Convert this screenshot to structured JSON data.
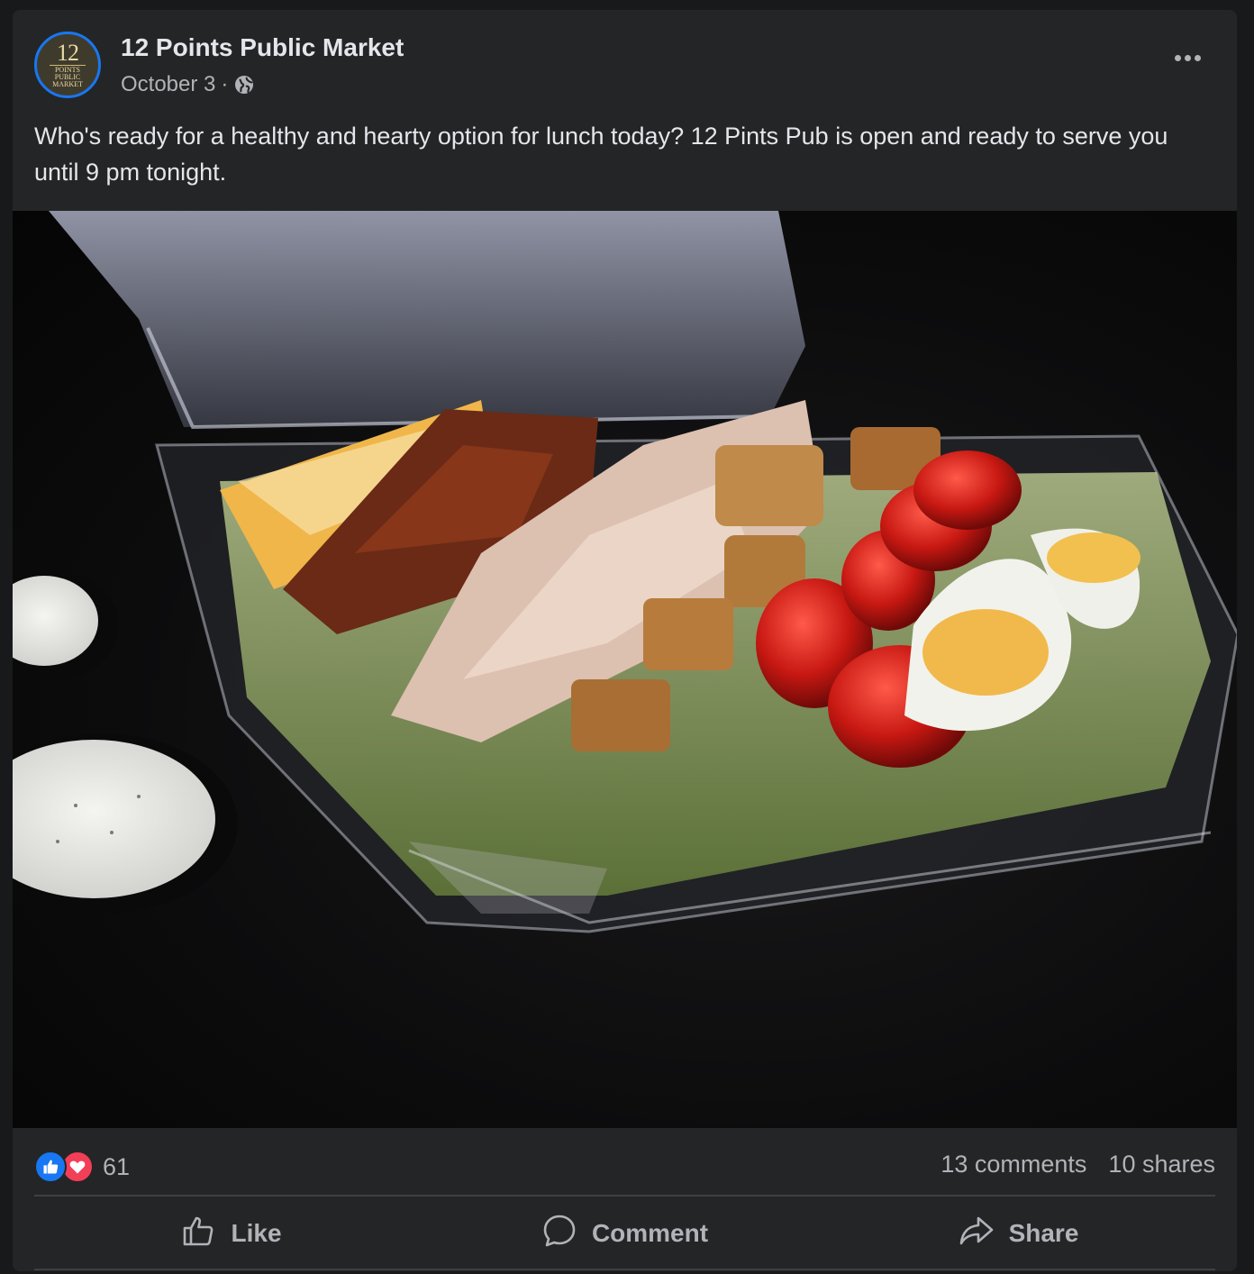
{
  "post": {
    "page_name": "12 Points Public Market",
    "avatar": {
      "number": "12",
      "line1": "POINTS",
      "line2": "PUBLIC",
      "line3": "MARKET",
      "ring_color": "#1877f2"
    },
    "date": "October 3",
    "date_separator": "·",
    "privacy_icon": "globe-icon",
    "more_icon": "more-horizontal-icon",
    "text": "Who's ready for a healthy and hearty option for lunch today? 12 Pints Pub is open and ready to serve you until 9 pm tonight.",
    "photo_icon": "salad-photo"
  },
  "stats": {
    "reactions": [
      {
        "type": "like",
        "icon": "like-reaction-icon",
        "color": "#1877f2"
      },
      {
        "type": "love",
        "icon": "love-reaction-icon",
        "color": "#f33e58"
      }
    ],
    "reaction_count": "61",
    "comments": "13 comments",
    "shares": "10 shares"
  },
  "actions": {
    "like": {
      "label": "Like",
      "icon": "thumbs-up-icon"
    },
    "comment": {
      "label": "Comment",
      "icon": "comment-bubble-icon"
    },
    "share": {
      "label": "Share",
      "icon": "share-arrow-icon"
    }
  },
  "colors": {
    "background": "#18191a",
    "card": "#242526",
    "primary_text": "#e4e6eb",
    "secondary_text": "#b0b3b8",
    "divider": "#3e4042"
  }
}
